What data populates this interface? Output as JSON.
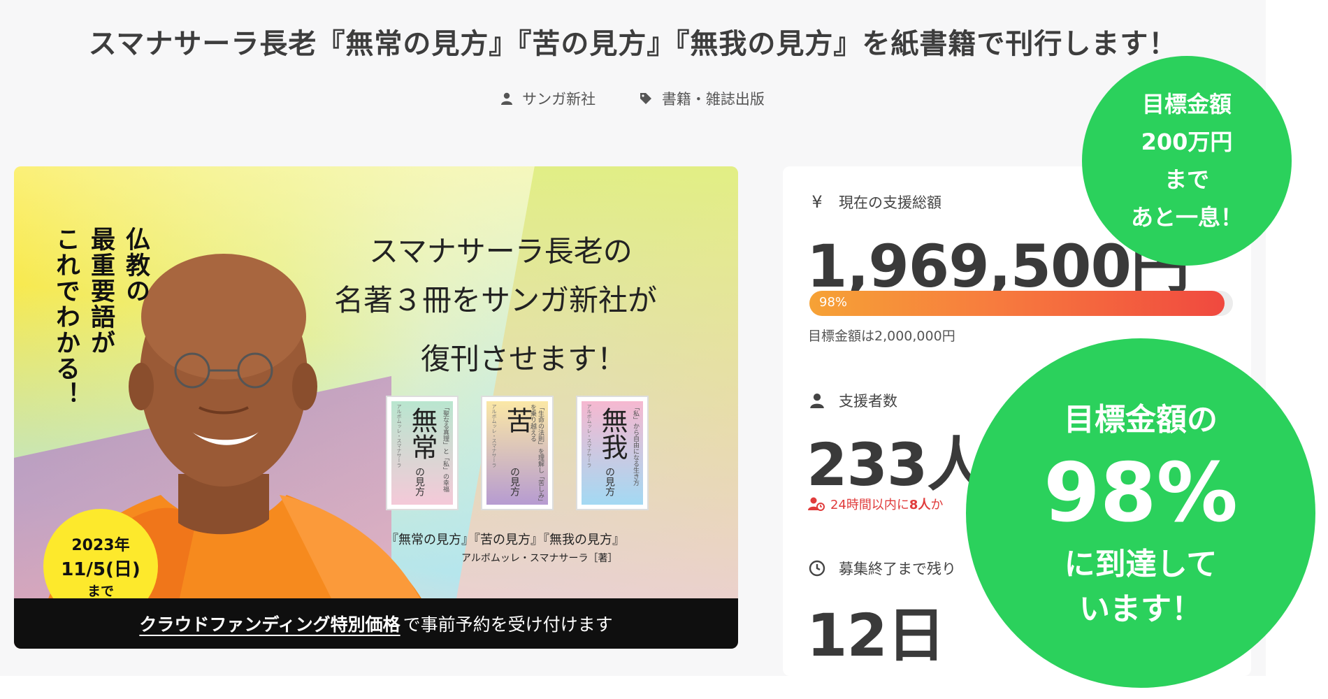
{
  "project": {
    "title": "スマナサーラ長老『無常の見方』『苦の見方』『無我の見方』を紙書籍で刊行します！",
    "owner": "サンガ新社",
    "category": "書籍・雑誌出版"
  },
  "hero": {
    "vertical_lines": [
      "仏教の",
      "最重要語が",
      "これでわかる！"
    ],
    "headline_lines": [
      "スマナサーラ長老の",
      "名著３冊をサンガ新社が",
      "復刊させます！"
    ],
    "books": [
      {
        "title": "無常",
        "sub": "の見方",
        "tag": "「聖なる真理」と「私」の幸福",
        "author": "アルボムッレ・スマナサーラ",
        "cover": "linear-gradient(180deg,#b9e6cf,#f4c9d8)"
      },
      {
        "title": "苦",
        "sub": "の見方",
        "tag": "「生命の法則」を理解し「苦しみ」を乗り越える",
        "author": "アルボムッレ・スマナサーラ",
        "cover": "linear-gradient(180deg,#fbe8a6,#b69bd1)"
      },
      {
        "title": "無我",
        "sub": "の見方",
        "tag": "「私」から自由になる生き方",
        "author": "アルボムッレ・スマナサーラ",
        "cover": "linear-gradient(180deg,#f6b8d0,#a3d9f3)"
      }
    ],
    "books_caption": "『無常の見方』『苦の見方』『無我の見方』",
    "books_author": "アルボムッレ・スマナサーラ［著］",
    "date_badge": {
      "year": "2023年",
      "day": "11/5(日)",
      "until": "まで"
    },
    "bar": {
      "strong": "クラウドファンディング特別価格",
      "rest": "で事前予約を受け付けます"
    }
  },
  "stats": {
    "total_label": "現在の支援総額",
    "total_value": "1,969,500円",
    "progress_percent": 98,
    "progress_text": "98%",
    "goal_note": "目標金額は2,000,000円",
    "backers_label": "支援者数",
    "backers_value": "233人",
    "recent_prefix": "24時間以内に",
    "recent_count": "8人",
    "recent_suffix": "か",
    "remaining_label": "募集終了まで残り",
    "remaining_value": "12日"
  },
  "badges": {
    "small_lines": [
      "目標金額",
      "200万円",
      "まで",
      "あと一息！"
    ],
    "big_top": "目標金額の",
    "big_percent": "98%",
    "big_bottom_lines": [
      "に到達して",
      "います！"
    ]
  },
  "colors": {
    "accent_green": "#2bd15c",
    "progress_start": "#f6a236",
    "progress_end": "#f0493f",
    "alert_red": "#e03c3c"
  },
  "icons": {
    "owner": "user-icon",
    "category": "tag-icon",
    "total": "yen-icon",
    "backers": "user-icon",
    "recent": "user-clock-icon",
    "remaining": "clock-icon"
  }
}
